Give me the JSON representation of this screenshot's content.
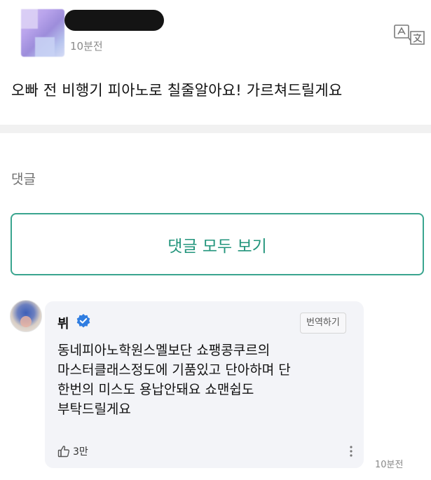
{
  "post": {
    "time": "10분전",
    "text": "오빠 전 비행기 피아노로 칠줄알아요! 가르쳐드릴게요"
  },
  "comments_section": {
    "label": "댓글",
    "view_all": "댓글 모두 보기"
  },
  "comment": {
    "author": "뷔",
    "translate": "번역하기",
    "body_lines": [
      "동네피아노학원스멜보단 쇼팽콩쿠르의",
      "마스터클래스정도에 기품있고 단아하며 단",
      "한번의 미스도 용납안돼요 쇼맨쉽도",
      "부탁드릴게요"
    ],
    "likes": "3만",
    "time": "10분전"
  },
  "colors": {
    "accent": "#23957c",
    "verified": "#2f7de1"
  }
}
